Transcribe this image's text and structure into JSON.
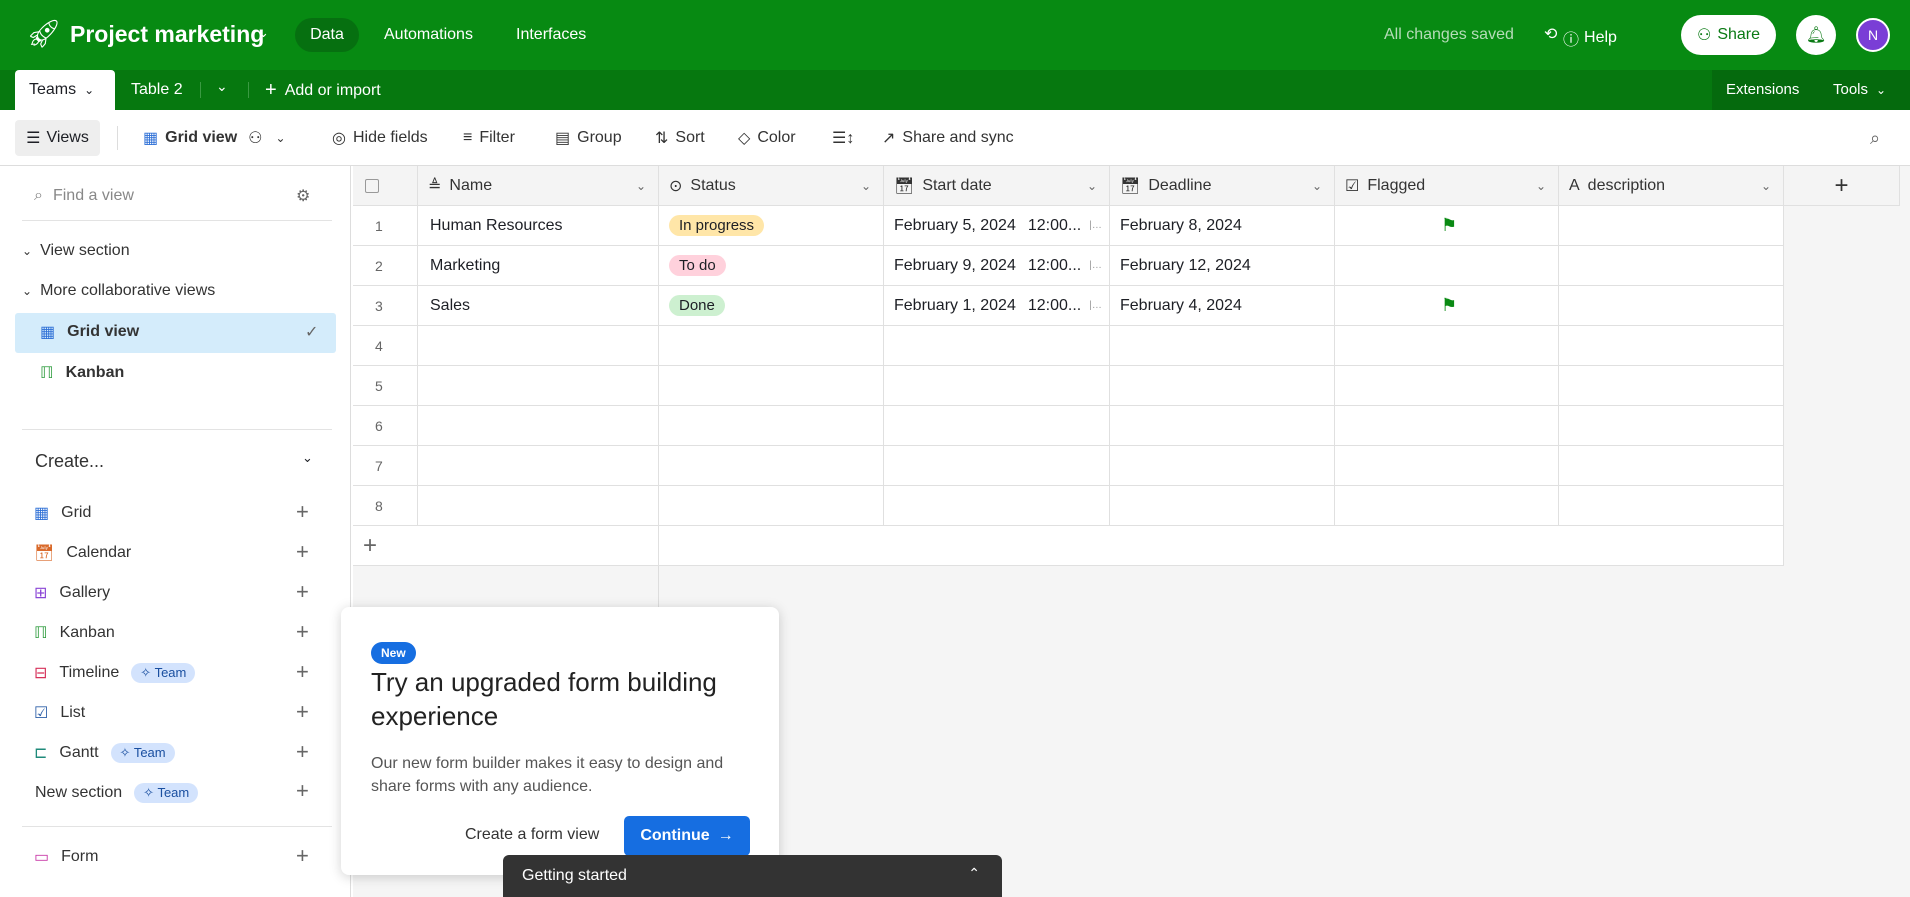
{
  "app": {
    "title": "Project marketing",
    "nav": [
      "Data",
      "Automations",
      "Interfaces"
    ],
    "status": "All changes saved",
    "help": "Help",
    "share": "Share",
    "avatar": "N"
  },
  "tabs": {
    "items": [
      "Teams",
      "Table 2"
    ],
    "add": "Add or import",
    "extensions": "Extensions",
    "tools": "Tools"
  },
  "toolbar": {
    "views": "Views",
    "view_name": "Grid view",
    "hide_fields": "Hide fields",
    "filter": "Filter",
    "group": "Group",
    "sort": "Sort",
    "color": "Color",
    "share_sync": "Share and sync"
  },
  "sidebar": {
    "search_placeholder": "Find a view",
    "sections": [
      "View section",
      "More collaborative views"
    ],
    "views": [
      "Grid view",
      "Kanban"
    ],
    "create_label": "Create...",
    "create_items": [
      {
        "label": "Grid",
        "color": "#2d6fd6"
      },
      {
        "label": "Calendar",
        "color": "#d9692a"
      },
      {
        "label": "Gallery",
        "color": "#8b46d6"
      },
      {
        "label": "Kanban",
        "color": "#2a9a3a"
      },
      {
        "label": "Timeline",
        "color": "#d6315a",
        "badge": "Team"
      },
      {
        "label": "List",
        "color": "#2d5fa8"
      },
      {
        "label": "Gantt",
        "color": "#1f8a7a",
        "badge": "Team"
      }
    ],
    "new_section": "New section",
    "team_badge": "Team",
    "form": "Form"
  },
  "table": {
    "columns": [
      "Name",
      "Status",
      "Start date",
      "Deadline",
      "Flagged",
      "description"
    ],
    "rows": [
      {
        "num": "1",
        "name": "Human Resources",
        "status": "In progress",
        "status_color": "#ffe6a8",
        "start": "February 5, 2024",
        "start_time": "12:00...",
        "deadline": "February 8, 2024",
        "flagged": true
      },
      {
        "num": "2",
        "name": "Marketing",
        "status": "To do",
        "status_color": "#ffd1dc",
        "start": "February 9, 2024",
        "start_time": "12:00...",
        "deadline": "February 12, 2024",
        "flagged": false
      },
      {
        "num": "3",
        "name": "Sales",
        "status": "Done",
        "status_color": "#cdf0d0",
        "start": "February 1, 2024",
        "start_time": "12:00...",
        "deadline": "February 4, 2024",
        "flagged": true
      }
    ],
    "empty_rows": [
      "4",
      "5",
      "6",
      "7",
      "8"
    ]
  },
  "popup": {
    "badge": "New",
    "title": "Try an upgraded form building experience",
    "body": "Our new form builder makes it easy to design and share forms with any audience.",
    "secondary": "Create a form view",
    "primary": "Continue"
  },
  "getting_started": "Getting started"
}
